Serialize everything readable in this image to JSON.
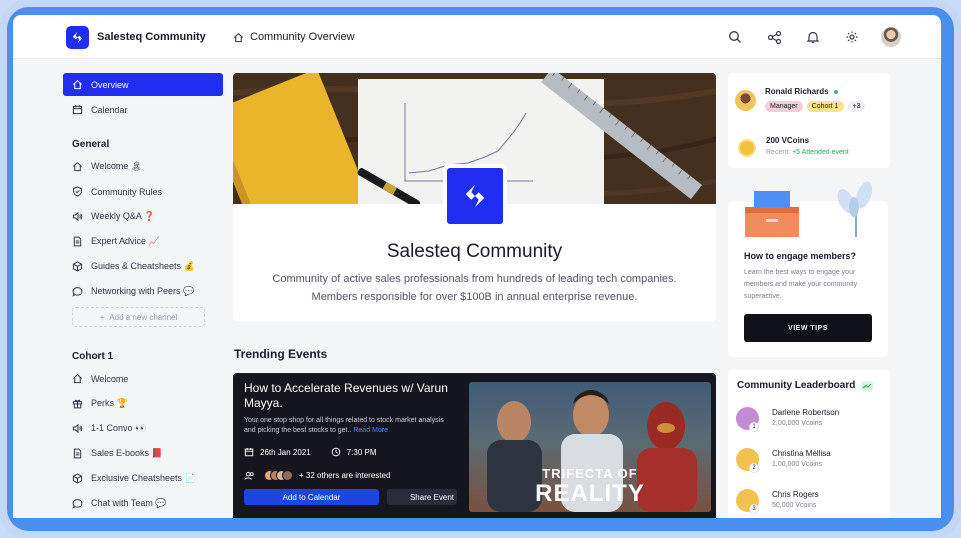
{
  "header": {
    "brand": "Salesteq Community",
    "breadcrumb": "Community Overview"
  },
  "sidebar": {
    "top_items": [
      {
        "label": "Overview",
        "icon": "home-icon",
        "active": true
      },
      {
        "label": "Calendar",
        "icon": "calendar-icon",
        "active": false
      }
    ],
    "sections": [
      {
        "title": "General",
        "items": [
          {
            "label": "Welcome 🏝",
            "icon": "home-icon"
          },
          {
            "label": "Community Rules",
            "icon": "shield-icon"
          },
          {
            "label": "Weekly Q&A ❓",
            "icon": "megaphone-icon"
          },
          {
            "label": "Expert Advice 📈",
            "icon": "document-icon"
          },
          {
            "label": "Guides & Cheatsheets 💰",
            "icon": "box-icon"
          },
          {
            "label": "Networking with Peers 💬",
            "icon": "chat-icon"
          }
        ],
        "add_label": "Add a new channel"
      },
      {
        "title": "Cohort 1",
        "items": [
          {
            "label": "Welcome",
            "icon": "home-icon"
          },
          {
            "label": "Perks 🏆",
            "icon": "gift-icon"
          },
          {
            "label": "1-1 Convo 👀",
            "icon": "megaphone-icon"
          },
          {
            "label": "Sales E-books 📕",
            "icon": "document-icon"
          },
          {
            "label": "Exclusive Cheatsheets 📄",
            "icon": "box-icon"
          },
          {
            "label": "Chat with Team 💬",
            "icon": "chat-icon"
          }
        ]
      }
    ]
  },
  "hero": {
    "title": "Salesteq Community",
    "description": "Community of active sales professionals from hundreds of leading tech companies. Members responsible for over $100B in annual enterprise revenue."
  },
  "trending": {
    "title": "Trending Events",
    "event": {
      "title": "How to Accelerate Revenues w/ Varun Mayya.",
      "description": "Your one stop shop for all things related to stock market analysis and picking the best stocks to get..",
      "read_more": "Read More",
      "date": "26th Jan 2021",
      "time": "7:30 PM",
      "interested": "+ 32 others are interested",
      "add_calendar_label": "Add to Calendar",
      "share_label": "Share Event",
      "poster_line1": "TRIFECTA OF",
      "poster_line2": "REALITY"
    }
  },
  "profile": {
    "name": "Ronald Richards",
    "tags": [
      "Manager",
      "Cohort 1",
      "+3"
    ],
    "vcoins": "200 VCoins",
    "recent_label": "Recent:",
    "recent_value": "+5 Attended event"
  },
  "engage": {
    "title": "How to engage members?",
    "description": "Learn the best ways to engage your members and make your community superactive.",
    "button_label": "VIEW TIPS"
  },
  "leaderboard": {
    "title": "Community Leaderboard",
    "rows": [
      {
        "rank": "1",
        "name": "Darlene Robertson",
        "vcoins": "2,00,000 Vcoins",
        "color": "#c58ad6"
      },
      {
        "rank": "2",
        "name": "Christina Mellisa",
        "vcoins": "1,00,000 Vcoins",
        "color": "#f2c14e"
      },
      {
        "rank": "3",
        "name": "Chris Rogers",
        "vcoins": "50,000 Vcoins",
        "color": "#f2c14e"
      }
    ]
  },
  "colors": {
    "accent": "#1f2ef0",
    "frame": "#4a8ef0"
  }
}
